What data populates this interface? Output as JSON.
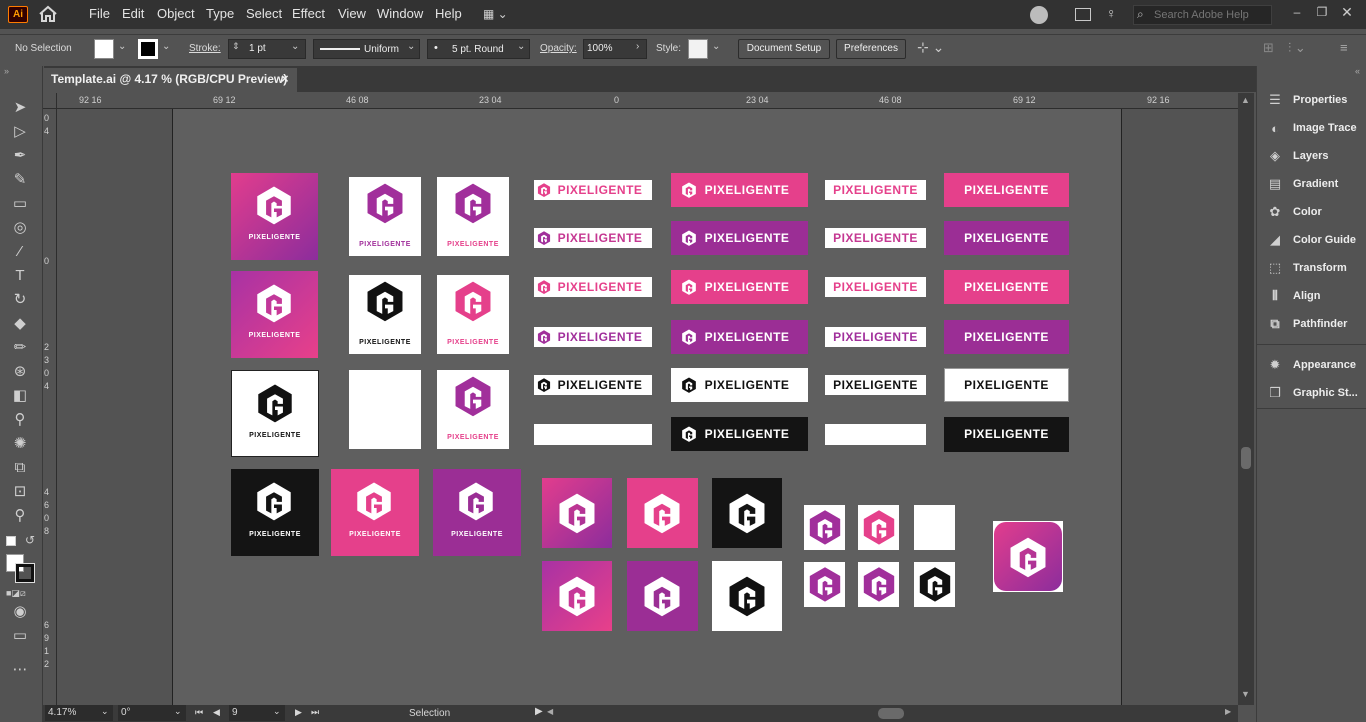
{
  "app": {
    "logo_text": "Ai"
  },
  "menu": [
    "File",
    "Edit",
    "Object",
    "Type",
    "Select",
    "Effect",
    "View",
    "Window",
    "Help"
  ],
  "search": {
    "placeholder": "Search Adobe Help"
  },
  "control": {
    "selection": "No Selection",
    "stroke_label": "Stroke:",
    "stroke_value": "1 pt",
    "profile": "Uniform",
    "brush": "5 pt. Round",
    "opacity_label": "Opacity:",
    "opacity_value": "100%",
    "style_label": "Style:",
    "document_setup": "Document Setup",
    "preferences": "Preferences"
  },
  "tab": {
    "title": "Template.ai @ 4.17 % (RGB/CPU Preview)",
    "close": "×"
  },
  "ruler": {
    "h_ticks": [
      "92 16",
      "69 12",
      "46 08",
      "23 04",
      "0",
      "23 04",
      "46 08",
      "69 12",
      "92 16"
    ],
    "v_ticks": [
      "0 4",
      "0",
      "2 3 0 4",
      "4 6 0 8",
      "6 9 1 2"
    ]
  },
  "panels": [
    "Properties",
    "Image Trace",
    "Layers",
    "Gradient",
    "Color",
    "Color Guide",
    "Transform",
    "Align",
    "Pathfinder",
    "Appearance",
    "Graphic St..."
  ],
  "status": {
    "zoom": "4.17%",
    "rotation": "0°",
    "artboard": "9",
    "tool": "Selection"
  },
  "brand": {
    "wordmark": "PIXELIGENTE",
    "mark": "PG"
  },
  "colors": {
    "pink": "#e5408b",
    "purple": "#9b2e95",
    "gradient_start": "#e23d8d",
    "gradient_end": "#8c2d9c"
  }
}
